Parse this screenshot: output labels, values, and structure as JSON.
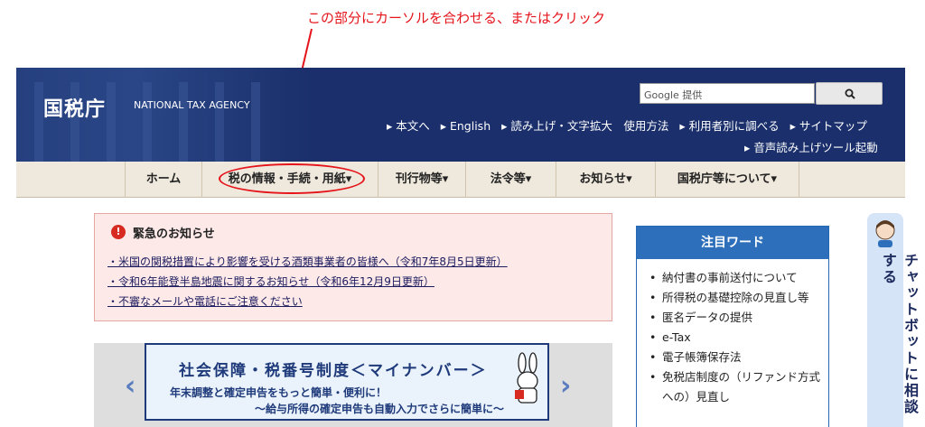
{
  "annotation": "この部分にカーソルを合わせる、またはクリック",
  "header": {
    "logo": "国税庁",
    "logo_en": "NATIONAL TAX AGENCY",
    "search_brand": "Google 提供",
    "links": [
      "▸ 本文へ",
      "▸ English",
      "▸ 読み上げ・文字拡大　使用方法",
      "▸ 利用者別に調べる",
      "▸ サイトマップ"
    ],
    "link_audio": "▸ 音声読み上げツール起動"
  },
  "nav": {
    "items": [
      "ホーム",
      "税の情報・手続・用紙▾",
      "刊行物等▾",
      "法令等▾",
      "お知らせ▾",
      "国税庁等について▾"
    ]
  },
  "alert": {
    "icon": "!",
    "title": "緊急のお知らせ",
    "links": [
      "・米国の関税措置により影響を受ける酒類事業者の皆様へ（令和7年8月5日更新）",
      "・令和6年能登半島地震に関するお知らせ（令和6年12月9日更新）",
      "・不審なメールや電話にご注意ください"
    ]
  },
  "banner": {
    "line1": "社会保障・税番号制度＜マイナンバー＞",
    "line2": "年末調整と確定申告をもっと簡単・便利に！",
    "line3": "～給与所得の確定申告も自動入力でさらに簡単に～",
    "prev": "‹",
    "next": "›"
  },
  "words": {
    "title": "注目ワード",
    "items": [
      "納付書の事前送付について",
      "所得税の基礎控除の見直し等",
      "匿名データの提供",
      "e-Tax",
      "電子帳簿保存法",
      "免税店制度の（リファンド方式への）見直し"
    ]
  },
  "chat": {
    "label": "チャットボットに相談する"
  },
  "colors": {
    "header_bg": "#1a2f6b",
    "nav_bg": "#efe8dc",
    "alert_bg": "#fde9e8",
    "accent_red": "#e5141b",
    "words_head": "#2d6fbb"
  }
}
